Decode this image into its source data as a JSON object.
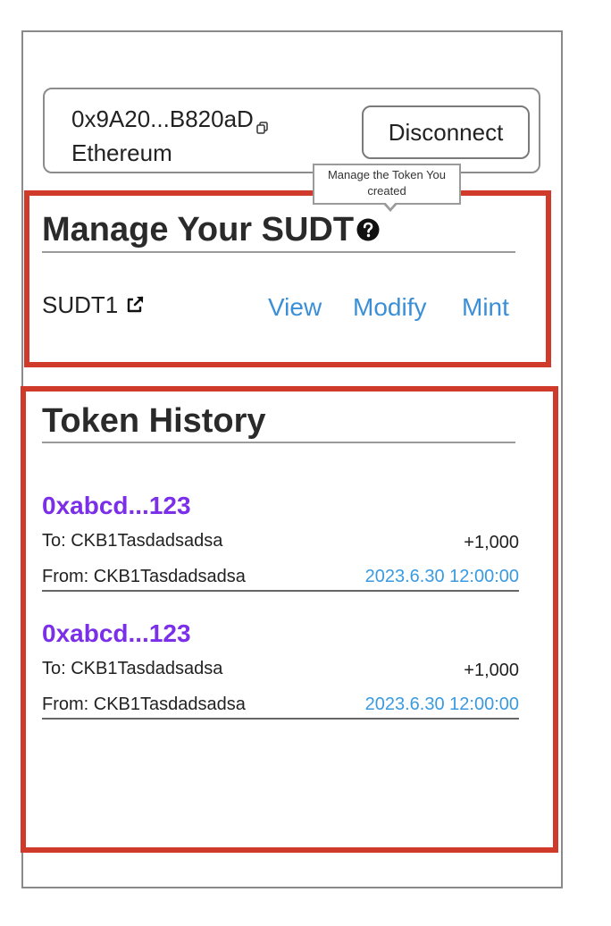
{
  "wallet": {
    "address": "0x9A20...B820aD",
    "network": "Ethereum",
    "disconnect_label": "Disconnect",
    "copy_icon": "copy-icon"
  },
  "tooltip": {
    "text": "Manage the Token You created"
  },
  "manage": {
    "title": "Manage Your SUDT",
    "help_icon": "question-circle-icon",
    "token": {
      "name": "SUDT1",
      "link_icon": "external-link-icon",
      "actions": [
        "View",
        "Modify",
        "Mint"
      ]
    }
  },
  "history": {
    "title": "Token History",
    "items": [
      {
        "hash": "0xabcd...123",
        "to": "To: CKB1Tasdadsadsa",
        "amount": "+1,000",
        "from": "From: CKB1Tasdadsadsa",
        "time": "2023.6.30 12:00:00"
      },
      {
        "hash": "0xabcd...123",
        "to": "To: CKB1Tasdadsadsa",
        "amount": "+1,000",
        "from": "From: CKB1Tasdadsadsa",
        "time": "2023.6.30 12:00:00"
      }
    ]
  },
  "colors": {
    "highlight_red": "#cf3a2b",
    "link_blue": "#3a8fd6",
    "hash_purple": "#7b2fe8",
    "time_blue": "#3a9ae0"
  }
}
